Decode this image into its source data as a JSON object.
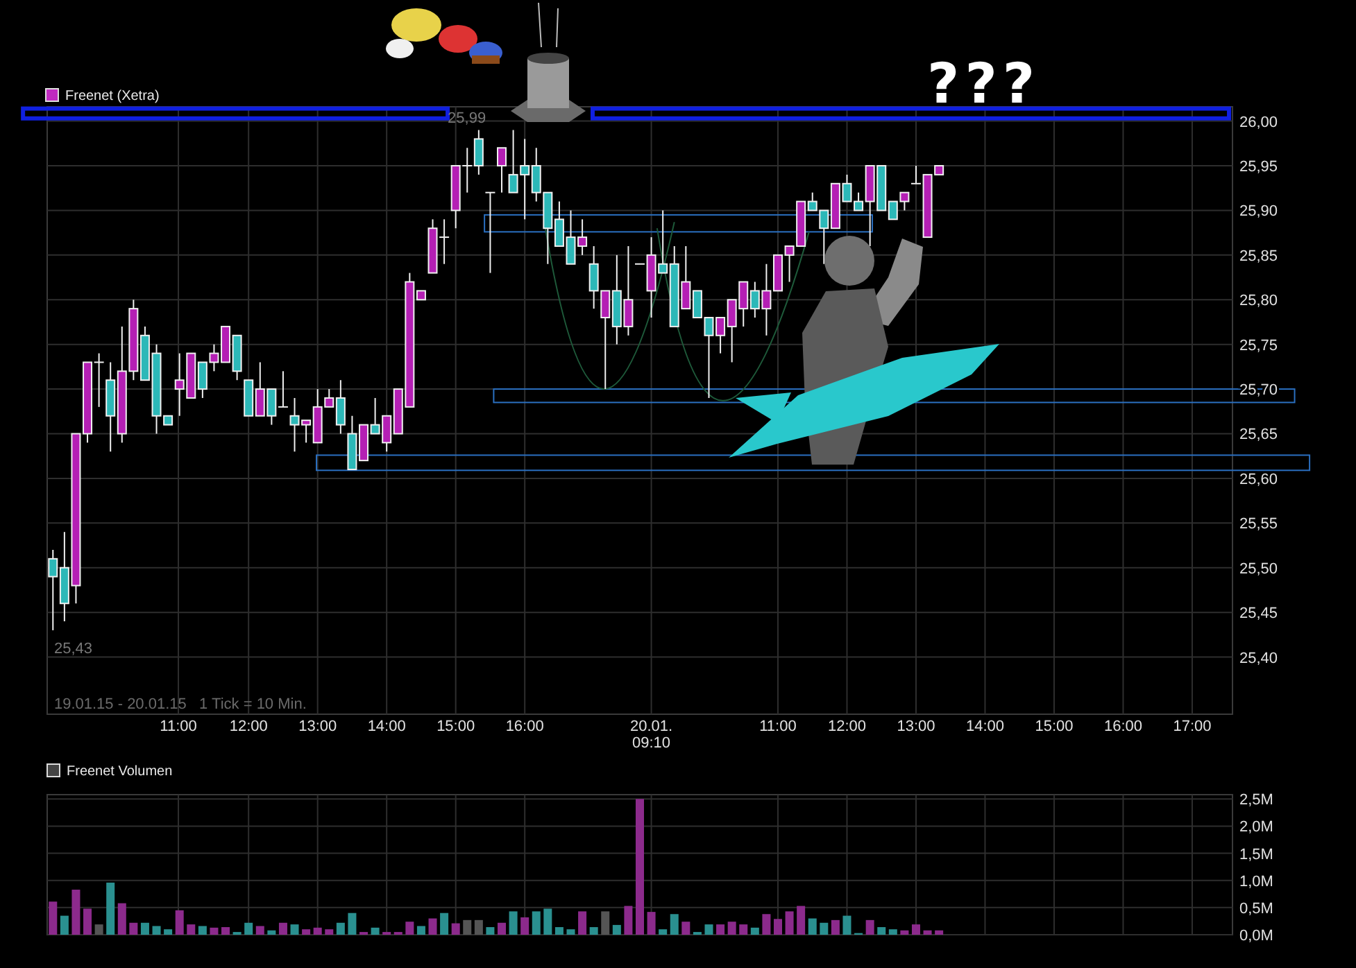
{
  "price_panel": {
    "legend": "Freenet (Xetra)",
    "y_axis_labels": [
      "26,00",
      "25,95",
      "25,90",
      "25,85",
      "25,80",
      "25,75",
      "25,70",
      "25,65",
      "25,60",
      "25,55",
      "25,50",
      "25,45",
      "25,40"
    ],
    "x_axis_labels": [
      [
        "11:00"
      ],
      [
        "12:00"
      ],
      [
        "13:00"
      ],
      [
        "14:00"
      ],
      [
        "15:00"
      ],
      [
        "16:00"
      ],
      [
        "20.01.",
        "09:10"
      ],
      [
        "11:00"
      ],
      [
        "12:00"
      ],
      [
        "13:00"
      ],
      [
        "14:00"
      ],
      [
        "15:00"
      ],
      [
        "16:00"
      ],
      [
        "17:00"
      ]
    ],
    "high_label": "25,99",
    "low_label": "25,43",
    "info_text": "19.01.15 - 20.01.15   1 Tick = 10 Min.",
    "callout": "???"
  },
  "volume_panel": {
    "chart_data": {
      "type": "bar",
      "title": "Freenet Volumen",
      "stacked": true,
      "grid": true,
      "categories": [
        null,
        null,
        null,
        null,
        null,
        null,
        null,
        null,
        null,
        null,
        null,
        null,
        null,
        null,
        null,
        null,
        null,
        null,
        null,
        null,
        null,
        null,
        null,
        null,
        null,
        null,
        null,
        null,
        null,
        null,
        null,
        null,
        null,
        null,
        null,
        null,
        null,
        null,
        null,
        null,
        null,
        null,
        null,
        null,
        null,
        null,
        null,
        null,
        null,
        null,
        null,
        null,
        null,
        null,
        null,
        null,
        null,
        null,
        null,
        null,
        null,
        null,
        null,
        null,
        null,
        null,
        null,
        null,
        null,
        null,
        null,
        null,
        null,
        null,
        null,
        null,
        null,
        null,
        null,
        null,
        null,
        null,
        null,
        null,
        null,
        null,
        null,
        null,
        null,
        null,
        null,
        null,
        null,
        null,
        null,
        null,
        null,
        null,
        null,
        null,
        null,
        null,
        null
      ],
      "series": [
        {
          "color": "#8c2a8c",
          "values": [
            0.61,
            null,
            0.83,
            0.48,
            null,
            null,
            0.58,
            0.22,
            null,
            null,
            null,
            0.45,
            0.19,
            null,
            0.13,
            0.14,
            null,
            null,
            0.16,
            null,
            0.22,
            null,
            0.1,
            0.13,
            0.1,
            null,
            null,
            0.05,
            null,
            0.05,
            0.05,
            0.24,
            null,
            0.3,
            null,
            0.21,
            null,
            null,
            null,
            0.22,
            null,
            0.32,
            null,
            null,
            null,
            null,
            0.43,
            null,
            null,
            null,
            0.53,
            2.5,
            0.42,
            null,
            null,
            0.24,
            null,
            null,
            0.19,
            0.24,
            0.19,
            null,
            0.38,
            0.29,
            0.43,
            0.53,
            null,
            null,
            0.27,
            null,
            null,
            0.27,
            null,
            null,
            0.08,
            0.19,
            0.08,
            0.08,
            null,
            null,
            null,
            null,
            null,
            null,
            null,
            null,
            null,
            null,
            null,
            null,
            null,
            null,
            null,
            null,
            null,
            null,
            null,
            null,
            null,
            null,
            null,
            null,
            null
          ]
        },
        {
          "color": "#2a9090",
          "values": [
            null,
            0.35,
            null,
            null,
            null,
            0.96,
            null,
            null,
            0.22,
            0.16,
            0.1,
            null,
            null,
            0.16,
            null,
            null,
            0.05,
            0.22,
            null,
            0.08,
            null,
            0.19,
            null,
            null,
            null,
            0.22,
            0.4,
            null,
            0.13,
            null,
            null,
            null,
            0.16,
            null,
            0.4,
            null,
            null,
            null,
            0.14,
            null,
            0.43,
            null,
            0.43,
            0.48,
            0.14,
            0.1,
            null,
            0.14,
            null,
            0.18,
            null,
            null,
            null,
            0.1,
            0.38,
            null,
            0.05,
            0.19,
            null,
            null,
            null,
            0.13,
            null,
            null,
            null,
            null,
            0.3,
            0.22,
            null,
            0.35,
            0.03,
            null,
            0.14,
            0.1,
            null,
            null,
            null,
            null,
            null,
            null,
            null,
            null,
            null,
            null,
            null,
            null,
            null,
            null,
            null,
            null,
            null,
            null,
            null,
            null,
            null,
            null,
            null,
            null,
            null,
            null,
            null,
            null,
            null
          ]
        },
        {
          "color": "#555555",
          "values": [
            null,
            null,
            null,
            null,
            0.19,
            null,
            null,
            null,
            null,
            null,
            null,
            null,
            null,
            null,
            null,
            null,
            null,
            null,
            null,
            null,
            null,
            null,
            null,
            null,
            null,
            null,
            null,
            null,
            null,
            null,
            null,
            null,
            null,
            null,
            null,
            null,
            0.27,
            0.27,
            null,
            null,
            null,
            null,
            null,
            null,
            null,
            null,
            null,
            null,
            0.43,
            null,
            null,
            null,
            null,
            null,
            null,
            null,
            null,
            null,
            null,
            null,
            null,
            null,
            null,
            null,
            null,
            null,
            null,
            null,
            null,
            null,
            null,
            null,
            null,
            null,
            null,
            null,
            null,
            null,
            null,
            null,
            null,
            null,
            null,
            null,
            null,
            null,
            null,
            null,
            null,
            null,
            null,
            null,
            null,
            null,
            null,
            null,
            null,
            null,
            null,
            null,
            null,
            null,
            null
          ]
        }
      ],
      "ylim": [
        0,
        2.58
      ],
      "yticks": [
        {
          "value": 2.5,
          "label": "2,5M"
        },
        {
          "value": 2.0,
          "label": "2,0M"
        },
        {
          "value": 1.5,
          "label": "1,5M"
        },
        {
          "value": 1.0,
          "label": "1,0M"
        },
        {
          "value": 0.5,
          "label": "0,5M"
        },
        {
          "value": 0,
          "label": "0,0M"
        }
      ]
    }
  }
}
